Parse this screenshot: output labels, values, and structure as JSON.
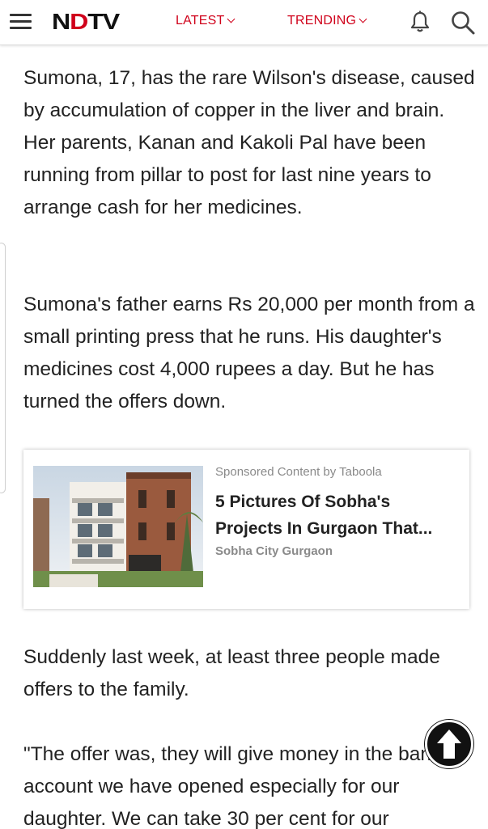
{
  "header": {
    "logo_text": "NDTV",
    "nav": [
      {
        "label": "LATEST"
      },
      {
        "label": "TRENDING"
      }
    ],
    "icons": [
      "menu-icon",
      "bell-icon",
      "search-icon"
    ],
    "accent_color": "#d0021b"
  },
  "article": {
    "paragraphs": [
      "Sumona, 17, has the rare Wilson's disease, caused by accumulation of copper in the liver and brain. Her parents, Kanan and Kakoli Pal have been running from pillar to post for last nine years to arrange cash for her medicines.",
      "Sumona's father earns Rs 20,000 per month from a small printing press that he runs. His daughter's medicines cost 4,000 rupees a day. But he has turned the offers down.",
      "Suddenly last week, at least three people made offers to the family.",
      "\"The offer was, they will give money in the bank account we have opened especially for our daughter. We can take 30 per cent for our"
    ]
  },
  "sponsored": {
    "label": "Sponsored Content by Taboola",
    "title": "5 Pictures Of Sobha's Projects In Gurgaon That...",
    "source": "Sobha City Gurgaon"
  },
  "scroll_top_icon": "arrow-up-icon"
}
